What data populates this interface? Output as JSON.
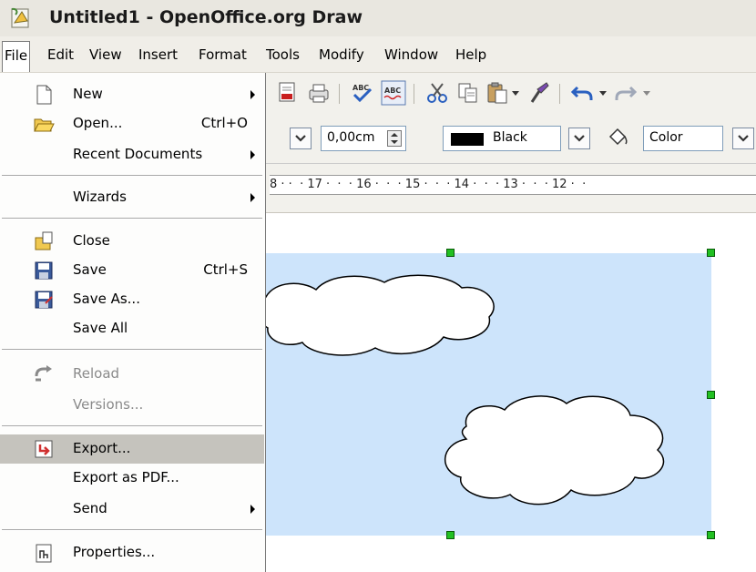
{
  "window": {
    "title": "Untitled1 - OpenOffice.org Draw",
    "app_icon": "openoffice-draw-icon"
  },
  "menubar": {
    "items": [
      {
        "label": "File",
        "active": true
      },
      {
        "label": "Edit"
      },
      {
        "label": "View"
      },
      {
        "label": "Insert"
      },
      {
        "label": "Format"
      },
      {
        "label": "Tools"
      },
      {
        "label": "Modify"
      },
      {
        "label": "Window"
      },
      {
        "label": "Help"
      }
    ]
  },
  "toolbar": {
    "line_width_value": "0,00cm",
    "line_color_value": "Black",
    "area_style_value": "Color"
  },
  "ruler": {
    "text": "8 · ·  · 17 ·  ·  · 16 ·  ·  · 15 ·  ·  · 14 ·  ·  · 13 ·  ·  · 12 ·  ·"
  },
  "file_menu": {
    "items": {
      "new": {
        "label": "New",
        "icon": "new-document-icon",
        "submenu": true
      },
      "open": {
        "label": "Open...",
        "shortcut": "Ctrl+O",
        "icon": "open-folder-icon"
      },
      "recent": {
        "label": "Recent Documents",
        "submenu": true
      },
      "wizards": {
        "label": "Wizards",
        "submenu": true
      },
      "close": {
        "label": "Close",
        "icon": "close-document-icon"
      },
      "save": {
        "label": "Save",
        "shortcut": "Ctrl+S",
        "icon": "save-icon"
      },
      "save_as": {
        "label": "Save As...",
        "icon": "save-as-icon"
      },
      "save_all": {
        "label": "Save All"
      },
      "reload": {
        "label": "Reload",
        "icon": "reload-icon",
        "disabled": true
      },
      "versions": {
        "label": "Versions...",
        "disabled": true
      },
      "export": {
        "label": "Export...",
        "icon": "export-icon",
        "highlighted": true
      },
      "export_pdf": {
        "label": "Export as PDF..."
      },
      "send": {
        "label": "Send",
        "submenu": true
      },
      "properties": {
        "label": "Properties...",
        "icon": "properties-icon"
      }
    }
  },
  "colors": {
    "menu_highlight": "#c5c3bd",
    "drawing_fill": "#cde4fb",
    "handle": "#22c022"
  }
}
